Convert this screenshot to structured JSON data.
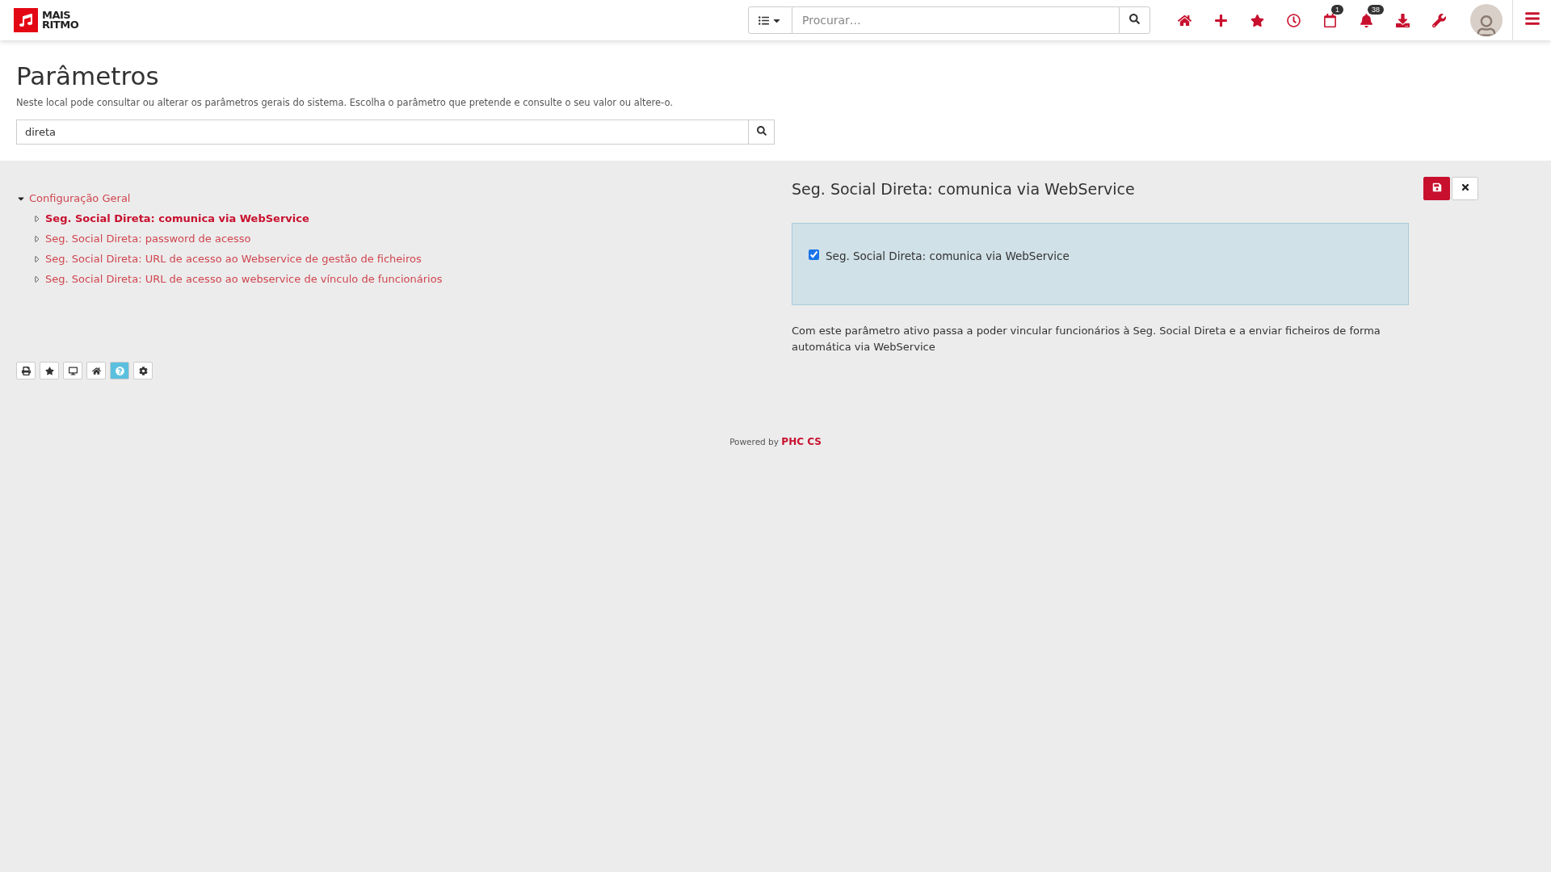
{
  "header": {
    "logo": [
      "MAIS",
      "RITMO"
    ],
    "search": {
      "placeholder": "Procurar…"
    },
    "icons": [
      {
        "kind": "home"
      },
      {
        "kind": "plus"
      },
      {
        "kind": "star"
      },
      {
        "kind": "clock"
      },
      {
        "kind": "calendar",
        "badge": "1"
      },
      {
        "kind": "bell",
        "badge": "38"
      },
      {
        "kind": "download"
      },
      {
        "kind": "wrench"
      }
    ]
  },
  "page": {
    "title": "Parâmetros",
    "subtitle": "Neste local pode consultar ou alterar os parâmetros gerais do sistema. Escolha o parâmetro que pretende e consulte o seu valor ou altere-o.",
    "filter": {
      "value": "direta"
    }
  },
  "tree": [
    {
      "label": "Configuração Geral",
      "expanded": true,
      "selected": false,
      "children": [
        {
          "label": "Seg. Social Direta: comunica via WebService",
          "expanded": false,
          "selected": true
        },
        {
          "label": "Seg. Social Direta: password de acesso",
          "expanded": false,
          "selected": false
        },
        {
          "label": "Seg. Social Direta: URL de acesso ao Webservice de gestão de ficheiros",
          "expanded": false,
          "selected": false
        },
        {
          "label": "Seg. Social Direta: URL de acesso ao webservice de vínculo de funcionários",
          "expanded": false,
          "selected": false
        }
      ]
    }
  ],
  "tools": [
    {
      "kind": "print",
      "on": false
    },
    {
      "kind": "star",
      "on": false
    },
    {
      "kind": "monitor",
      "on": false
    },
    {
      "kind": "home-plus",
      "on": false
    },
    {
      "kind": "help",
      "on": true
    },
    {
      "kind": "gear",
      "on": false
    }
  ],
  "detail": {
    "title": "Seg. Social Direta: comunica via WebService",
    "option": {
      "label": "Seg. Social Direta: comunica via WebService",
      "checked": true
    },
    "description": "Com este parâmetro ativo passa a poder vincular funcionários à Seg. Social Direta e a enviar ficheiros de forma automática via WebService"
  },
  "footer": {
    "prefix": "Powered by",
    "brand": "PHC CS"
  }
}
